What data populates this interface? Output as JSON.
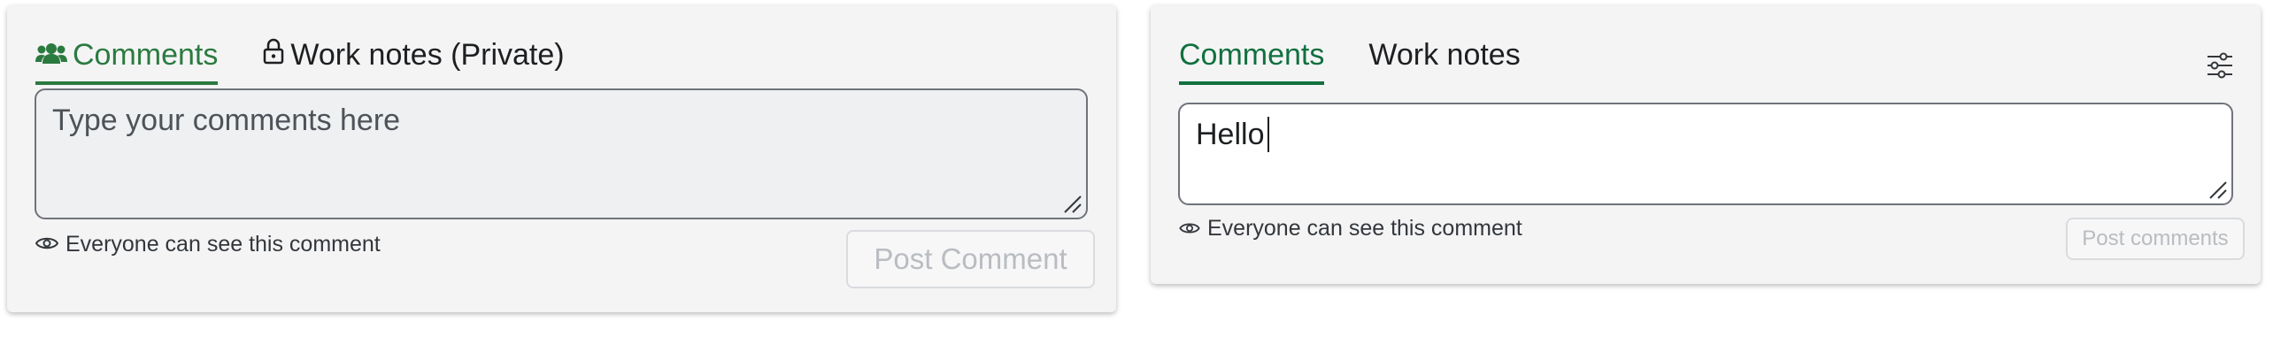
{
  "left_panel": {
    "tabs": [
      {
        "label": "Comments",
        "icon": "users-icon",
        "active": true
      },
      {
        "label": "Work notes (Private)",
        "icon": "lock-icon",
        "active": false
      }
    ],
    "textarea": {
      "placeholder": "Type your comments here",
      "value": ""
    },
    "visibility_text": "Everyone can see this comment",
    "post_button_label": "Post Comment"
  },
  "right_panel": {
    "tabs": [
      {
        "label": "Comments",
        "active": true
      },
      {
        "label": "Work notes",
        "active": false
      }
    ],
    "settings_icon": "sliders-icon",
    "textarea": {
      "value": "Hello"
    },
    "visibility_text": "Everyone can see this comment",
    "post_button_label": "Post comments"
  },
  "colors": {
    "accent_green_left": "#2b7a3f",
    "accent_green_right": "#11703e",
    "disabled_text": "#b9bcc0"
  }
}
